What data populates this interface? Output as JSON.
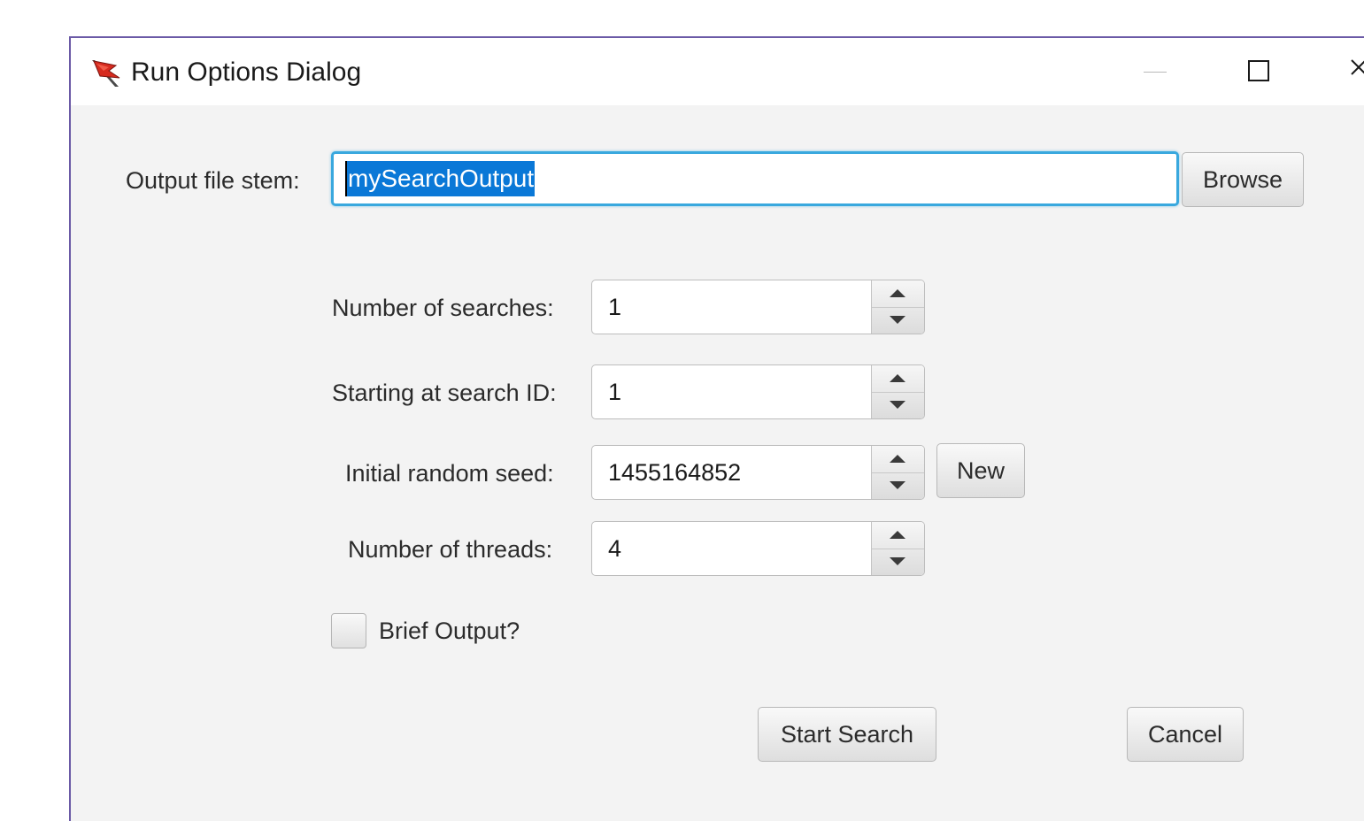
{
  "window": {
    "title": "Run Options Dialog",
    "icon": "red-flag-icon",
    "controls": [
      "minimize-icon",
      "maximize-icon",
      "close-icon"
    ]
  },
  "output": {
    "label": "Output file stem:",
    "value": "mySearchOutput",
    "browse_label": "Browse"
  },
  "fields": {
    "num_searches": {
      "label": "Number of searches:",
      "value": "1"
    },
    "start_id": {
      "label": "Starting at search ID:",
      "value": "1"
    },
    "seed": {
      "label": "Initial random seed:",
      "value": "1455164852",
      "new_label": "New"
    },
    "threads": {
      "label": "Number of threads:",
      "value": "4"
    }
  },
  "brief": {
    "label": "Brief Output?",
    "checked": false
  },
  "actions": {
    "start_label": "Start Search",
    "cancel_label": "Cancel"
  },
  "colors": {
    "focus": "#39a8de",
    "selection": "#0a78d7",
    "window_border": "#6b5aa6"
  }
}
